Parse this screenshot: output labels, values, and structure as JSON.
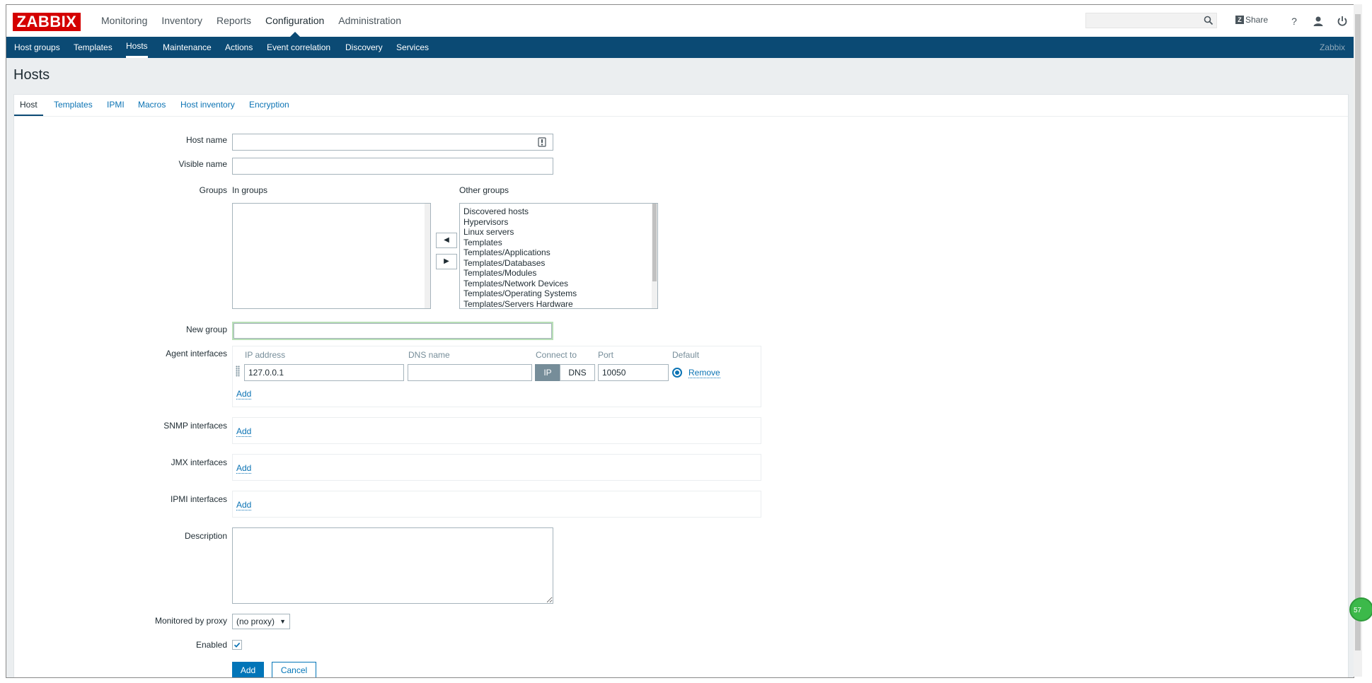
{
  "brand": {
    "logo": "ZABBIX",
    "footer_brand": "Zabbix"
  },
  "main_nav": [
    "Monitoring",
    "Inventory",
    "Reports",
    "Configuration",
    "Administration"
  ],
  "top_right": {
    "share_badge": "Z",
    "share_label": "Share",
    "help_glyph": "?"
  },
  "sub_nav": [
    "Host groups",
    "Templates",
    "Hosts",
    "Maintenance",
    "Actions",
    "Event correlation",
    "Discovery",
    "Services"
  ],
  "page": {
    "title": "Hosts"
  },
  "tabs": [
    "Host",
    "Templates",
    "IPMI",
    "Macros",
    "Host inventory",
    "Encryption"
  ],
  "form": {
    "host_name_label": "Host name",
    "host_name_value": "",
    "visible_name_label": "Visible name",
    "visible_name_value": "",
    "groups_label": "Groups",
    "in_groups_label": "In groups",
    "other_groups_label": "Other groups",
    "other_groups": [
      "Discovered hosts",
      "Hypervisors",
      "Linux servers",
      "Templates",
      "Templates/Applications",
      "Templates/Databases",
      "Templates/Modules",
      "Templates/Network Devices",
      "Templates/Operating Systems",
      "Templates/Servers Hardware"
    ],
    "move_left_glyph": "◀",
    "move_right_glyph": "▶",
    "new_group_label": "New group",
    "new_group_value": "",
    "agent_interfaces_label": "Agent interfaces",
    "iface_headers": {
      "ip": "IP address",
      "dns": "DNS name",
      "connect": "Connect to",
      "port": "Port",
      "default": "Default"
    },
    "agent_interface": {
      "ip": "127.0.0.1",
      "dns": "",
      "connect_ip": "IP",
      "connect_dns": "DNS",
      "port": "10050",
      "remove": "Remove"
    },
    "add_link": "Add",
    "snmp_label": "SNMP interfaces",
    "jmx_label": "JMX interfaces",
    "ipmi_label": "IPMI interfaces",
    "description_label": "Description",
    "description_value": "",
    "proxy_label": "Monitored by proxy",
    "proxy_value": "(no proxy)",
    "enabled_label": "Enabled",
    "enabled_checked": true,
    "submit_label": "Add",
    "cancel_label": "Cancel"
  },
  "widget": {
    "badge": "57"
  },
  "colors": {
    "header": "#0b4a74",
    "link": "#0b73b4",
    "logo": "#d40000",
    "primary_button": "#0275b8"
  }
}
